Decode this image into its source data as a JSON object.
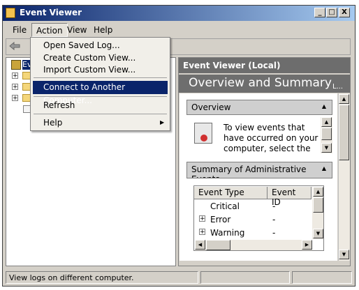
{
  "window": {
    "title": "Event Viewer",
    "min_label": "_",
    "max_label": "□",
    "close_label": "X"
  },
  "menubar": {
    "items": [
      "File",
      "Action",
      "View",
      "Help"
    ]
  },
  "tree": {
    "root_label": "Ev"
  },
  "right": {
    "header": "Event Viewer (Local)",
    "hero": "Overview and Summary",
    "hero_more": "L...",
    "overview": {
      "title": "Overview",
      "text": "To view events that have occurred on your computer, select the"
    },
    "summary": {
      "title": "Summary of Administrative Events",
      "columns": [
        "Event Type",
        "Event ID"
      ],
      "rows": [
        {
          "type": "Critical",
          "id": "-"
        },
        {
          "type": "Error",
          "id": "-"
        },
        {
          "type": "Warning",
          "id": "-"
        }
      ]
    }
  },
  "action_menu": {
    "items": [
      {
        "label": "Open Saved Log..."
      },
      {
        "label": "Create Custom View..."
      },
      {
        "label": "Import Custom View..."
      },
      {
        "label": "Connect to Another Computer..."
      },
      {
        "label": "Refresh"
      },
      {
        "label": "Help",
        "submenu_glyph": "▶"
      }
    ]
  },
  "statusbar": {
    "text": "View logs on different computer."
  },
  "colors": {
    "titlebar": "#0a246a",
    "highlight": "#0a246a",
    "pane_header": "#6d6d6d"
  }
}
